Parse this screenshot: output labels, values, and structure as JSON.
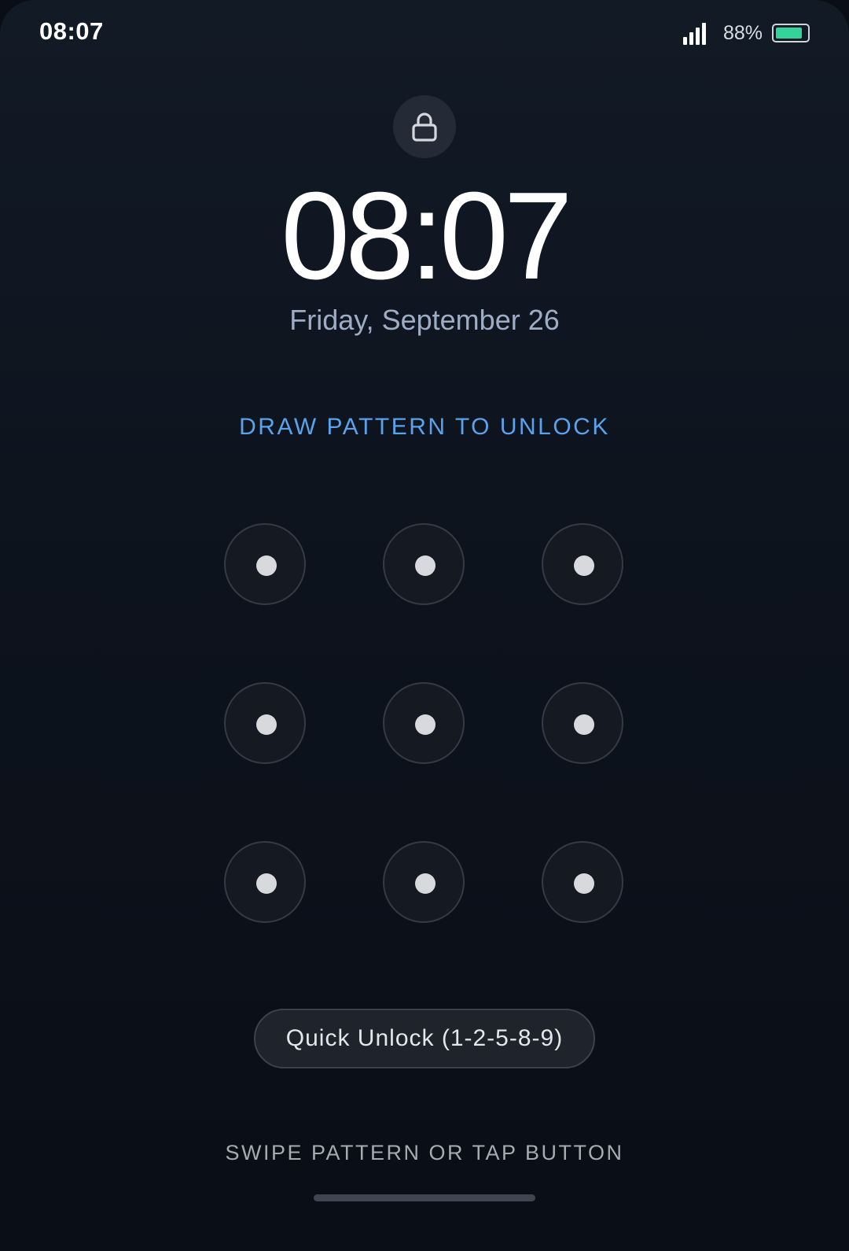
{
  "status_bar": {
    "time": "08:07",
    "battery_percent_label": "88%",
    "battery_level": 0.88,
    "signal_bars": 4,
    "battery_color": "#34d399"
  },
  "lock_screen": {
    "lock_icon": "lock-icon",
    "clock": "08:07",
    "date": "Friday, September 26",
    "instruction": "DRAW PATTERN TO UNLOCK",
    "pattern_nodes": [
      1,
      2,
      3,
      4,
      5,
      6,
      7,
      8,
      9
    ],
    "quick_unlock_label": "Quick Unlock (1-2-5-8-9)",
    "hint": "SWIPE PATTERN OR TAP BUTTON",
    "accent_color": "#5aa2ec"
  }
}
